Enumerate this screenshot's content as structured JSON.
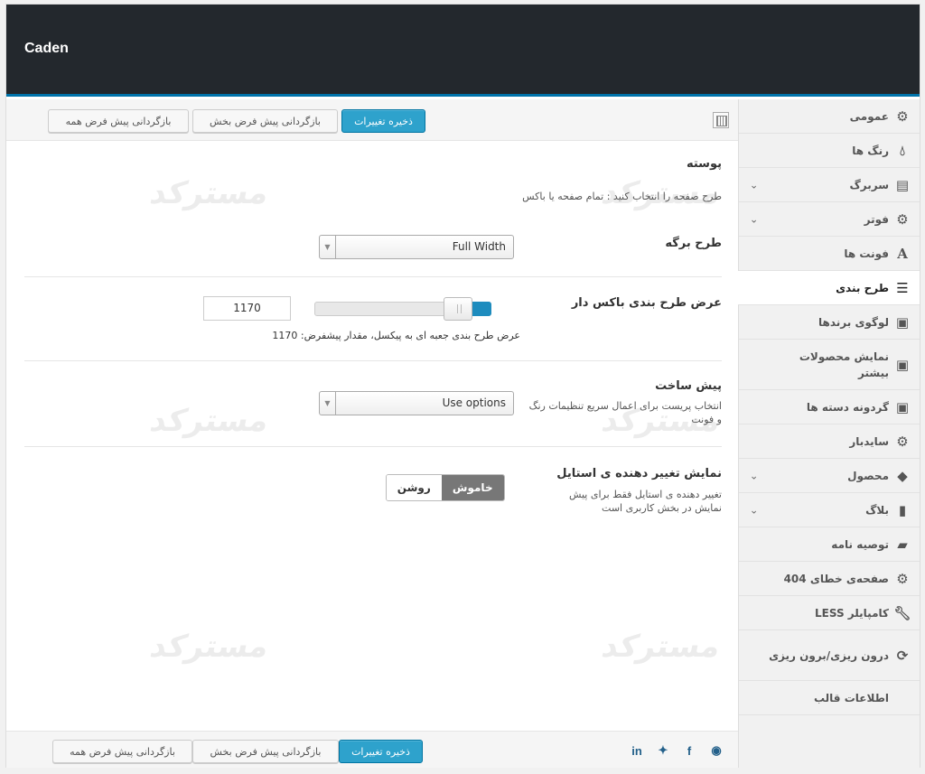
{
  "app": {
    "title": "Caden"
  },
  "toolbar": {
    "save_label": "ذخیره تغییرات",
    "reset_section_label": "بازگردانی پیش فرض بخش",
    "reset_all_label": "بازگردانی پیش فرض همه"
  },
  "sidebar": {
    "items": [
      {
        "label": "عمومی",
        "icon": "gear-icon"
      },
      {
        "label": "رنگ ها",
        "icon": "drop-icon"
      },
      {
        "label": "سربرگ",
        "icon": "header-icon"
      },
      {
        "label": "فوتر",
        "icon": "gear-icon"
      },
      {
        "label": "فونت ها",
        "icon": "font-icon"
      },
      {
        "label": "طرح بندی",
        "icon": "list-icon"
      },
      {
        "label": "لوگوی برندها",
        "icon": "briefcase-icon"
      },
      {
        "label": "نمایش محصولات بیشتر",
        "icon": "briefcase-icon"
      },
      {
        "label": "گردونه دسته ها",
        "icon": "briefcase-icon"
      },
      {
        "label": "سایدبار",
        "icon": "gear-icon"
      },
      {
        "label": "محصول",
        "icon": "tags-icon"
      },
      {
        "label": "بلاگ",
        "icon": "document-icon"
      },
      {
        "label": "توصیه نامه",
        "icon": "comment-icon"
      },
      {
        "label": "صفحه‌ی خطای 404",
        "icon": "gear-icon"
      },
      {
        "label": "کامپایلر LESS",
        "icon": "wrench-icon"
      },
      {
        "label": "درون ریزی/برون ریزی",
        "icon": "refresh-icon"
      },
      {
        "label": "اطلاعات قالب",
        "icon": ""
      }
    ]
  },
  "main": {
    "section": {
      "title": "پوسته",
      "desc": "طرح صفحه را انتخاب کنید : تمام صفحه یا باکس"
    },
    "page_layout": {
      "label": "طرح برگه",
      "value": "Full Width"
    },
    "boxed_width": {
      "label": "عرض طرح بندی باکس دار",
      "value": "1170",
      "level_percent": 87,
      "desc": "عرض طرح بندی جعبه ای به پیکسل، مقدار پیشفرض: 1170"
    },
    "preset": {
      "label": "پیش ساخت",
      "value": "Use options",
      "desc": "انتخاب پریست برای اعمال سریع تنظیمات رنگ و فونت"
    },
    "style_switcher": {
      "label": "نمایش تغییر دهنده ی استایل",
      "on_label": "خاموش",
      "off_label": "روشن",
      "desc": "تغییر دهنده ی استایل فقط برای پیش نمایش در بخش کاربری است"
    },
    "watermark": "مسترکد"
  },
  "colors": {
    "topbar": "#23282d",
    "accent": "#0073aa",
    "primary_button": "#2ea2cc"
  }
}
